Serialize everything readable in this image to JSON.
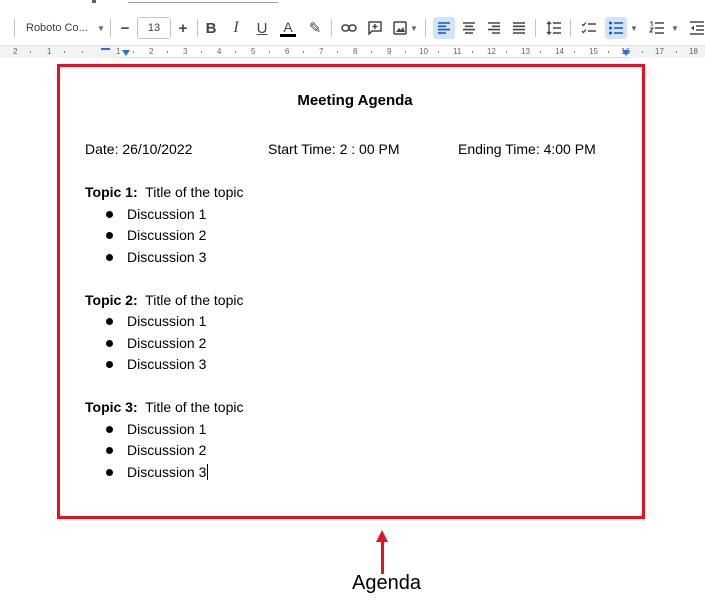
{
  "toolbar": {
    "font_name": "Roboto Co...",
    "font_size": "13",
    "minus": "−",
    "plus": "+",
    "bold": "B",
    "italic": "I",
    "underline": "U",
    "text_color": "A",
    "highlight_icon": "✎"
  },
  "ruler": {
    "ticks": [
      "2",
      "1",
      "1",
      "2",
      "3",
      "4",
      "5",
      "6",
      "7",
      "8",
      "9",
      "10",
      "11",
      "12",
      "13",
      "14",
      "15",
      "16",
      "17",
      "18"
    ]
  },
  "document": {
    "title": "Meeting Agenda",
    "date": "Date: 26/10/2022",
    "start_time": "Start Time: 2 : 00 PM",
    "end_time": "Ending Time: 4:00 PM",
    "topics": [
      {
        "label": "Topic 1:",
        "title": "Title of the topic",
        "items": [
          "Discussion 1",
          "Discussion 2",
          "Discussion 3"
        ]
      },
      {
        "label": "Topic 2:",
        "title": "Title of the topic",
        "items": [
          "Discussion 1",
          "Discussion 2",
          "Discussion 3"
        ]
      },
      {
        "label": "Topic 3:",
        "title": "Title of the topic",
        "items": [
          "Discussion 1",
          "Discussion 2",
          "Discussion 3"
        ]
      }
    ]
  },
  "annotation": {
    "label": "Agenda",
    "color": "#e81123"
  },
  "colors": {
    "active_button_bg": "#d3e3fd",
    "accent": "#1a73e8"
  }
}
